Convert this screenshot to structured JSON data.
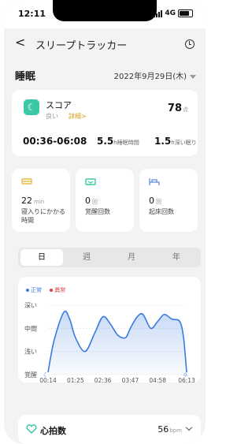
{
  "status_bar": {
    "time": "12:11",
    "network": "4G"
  },
  "nav": {
    "back_label": "<",
    "title": "スリープトラッカー"
  },
  "section": {
    "name": "睡眠",
    "date": "2022年9月29日(木)"
  },
  "score_card": {
    "title": "スコア",
    "quality": "良い",
    "details_link": "詳細>",
    "score": "78",
    "score_unit": "点",
    "time_range": "00:36-06:08",
    "sleep_hours": "5.5",
    "sleep_hours_unit": "h睡眠時間",
    "deep_hours": "1.5",
    "deep_hours_unit": "h深い眠り"
  },
  "stats": [
    {
      "icon": "bed-icon",
      "value": "22",
      "unit": "min",
      "label": "寝入りにかかる時間",
      "color": "#e8b94a"
    },
    {
      "icon": "wake-icon",
      "value": "0",
      "unit": "回",
      "label": "覚醒回数",
      "color": "#3cc7a6"
    },
    {
      "icon": "getup-icon",
      "value": "0",
      "unit": "回",
      "label": "起床回数",
      "color": "#5a8fd8"
    }
  ],
  "tabs": [
    {
      "label": "日",
      "active": true
    },
    {
      "label": "週",
      "active": false
    },
    {
      "label": "月",
      "active": false
    },
    {
      "label": "年",
      "active": false
    }
  ],
  "chart_data": {
    "type": "area",
    "legend": [
      {
        "name": "正常",
        "color": "#3a7be0"
      },
      {
        "name": "異常",
        "color": "#e04040"
      }
    ],
    "y_categories": [
      "深い",
      "中間",
      "浅い",
      "覚醒"
    ],
    "x_ticks": [
      "00:14",
      "01:25",
      "02:36",
      "03:47",
      "04:58",
      "06:13"
    ],
    "series": [
      {
        "name": "正常",
        "x": [
          "00:14",
          "00:30",
          "00:55",
          "01:10",
          "01:25",
          "01:50",
          "02:15",
          "02:36",
          "02:55",
          "03:15",
          "03:35",
          "03:47",
          "04:05",
          "04:20",
          "04:40",
          "04:58",
          "05:15",
          "05:35",
          "05:55",
          "06:05",
          "06:13"
        ],
        "y": [
          0.1,
          1.5,
          2.7,
          2.4,
          1.6,
          1.0,
          1.8,
          2.5,
          2.2,
          1.7,
          1.6,
          2.0,
          2.5,
          2.6,
          2.0,
          2.3,
          2.6,
          2.4,
          2.3,
          1.6,
          0.1
        ]
      }
    ],
    "y_value_meaning": "0 = 覚醒, 1 = 浅い, 2 = 中間, 3 = 深い",
    "start_icon": "moon-icon",
    "end_icon": "sun-icon"
  },
  "heart_rate": {
    "title": "心拍数",
    "value": "56",
    "unit": "bpm"
  }
}
